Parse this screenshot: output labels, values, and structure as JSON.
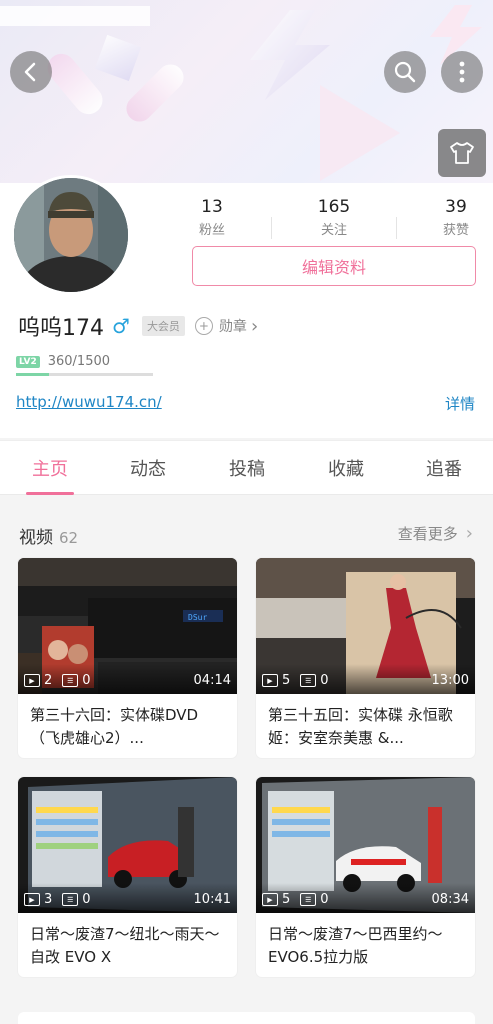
{
  "header": {
    "back_icon": "chevron-left-icon",
    "search_icon": "search-icon",
    "more_icon": "more-vertical-icon",
    "dress_icon": "tshirt-icon"
  },
  "profile": {
    "stats": [
      {
        "value": "13",
        "label": "粉丝"
      },
      {
        "value": "165",
        "label": "关注"
      },
      {
        "value": "39",
        "label": "获赞"
      }
    ],
    "edit_label": "编辑资料",
    "name": "呜呜174",
    "gender_symbol": "♂",
    "vip_label": "大会员",
    "medal_label": "勋章",
    "medal_chevron": "›",
    "level_badge": "LV2",
    "exp_text": "360/1500",
    "exp_fraction": 0.24,
    "link": "http://wuwu174.cn/",
    "detail_label": "详情"
  },
  "tabs": [
    "主页",
    "动态",
    "投稿",
    "收藏",
    "追番"
  ],
  "videos_section": {
    "title": "视频",
    "count": "62",
    "see_more": "查看更多",
    "chevron": "›"
  },
  "videos": [
    {
      "plays": "2",
      "comments": "0",
      "duration": "04:14",
      "title": "第三十六回：实体碟DVD（飞虎雄心2）..."
    },
    {
      "plays": "5",
      "comments": "0",
      "duration": "13:00",
      "title": "第三十五回：实体碟 永恒歌姬：安室奈美惠 &..."
    },
    {
      "plays": "3",
      "comments": "0",
      "duration": "10:41",
      "title": "日常～废渣7～纽北～雨天～自改 EVO X"
    },
    {
      "plays": "5",
      "comments": "0",
      "duration": "08:34",
      "title": "日常～废渣7～巴西里约～EVO6.5拉力版"
    }
  ],
  "colors": {
    "accent": "#f0709a",
    "link": "#1f86c5",
    "level": "#7dd5a6",
    "male": "#27a3dc"
  }
}
